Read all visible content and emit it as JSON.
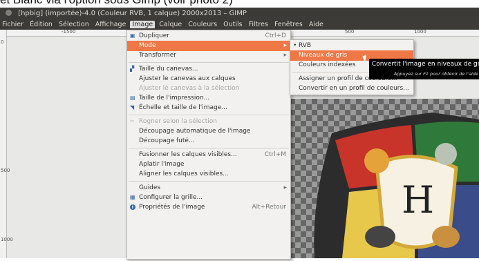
{
  "caption": "et Blanc via l'option sous Gimp (voir photo 2)",
  "window": {
    "title": "[hpbig] (importée)-4.0 (Couleur RVB, 1 calque) 2000x2013 – GIMP"
  },
  "menubar": [
    "Fichier",
    "Édition",
    "Sélection",
    "Affichage",
    "Image",
    "Calque",
    "Couleurs",
    "Outils",
    "Filtres",
    "Fenêtres",
    "Aide"
  ],
  "ruler": {
    "h": [
      "-1500",
      "500",
      "1000"
    ],
    "v": [
      "0",
      "500",
      "1000"
    ]
  },
  "image_menu": {
    "items": [
      {
        "label": "Dupliquer",
        "shortcut": "Ctrl+D",
        "icon": "duplicate-icon",
        "glyph": "▣"
      },
      {
        "label": "Mode",
        "submenu": true
      },
      {
        "label": "Transformer",
        "submenu": true
      },
      {
        "label": "Taille du canevas...",
        "icon": "canvas-size-icon",
        "glyph": "▞"
      },
      {
        "label": "Ajuster le canevas aux calques"
      },
      {
        "label": "Ajuster le canevas à la sélection",
        "disabled": true
      },
      {
        "label": "Taille de l'impression...",
        "icon": "print-size-icon",
        "glyph": "▤"
      },
      {
        "label": "Échelle et taille de l'image...",
        "icon": "scale-image-icon",
        "glyph": "◥"
      },
      {
        "label": "Rogner selon la sélection",
        "icon": "crop-icon",
        "glyph": "✂",
        "disabled": true
      },
      {
        "label": "Découpage automatique de l'image"
      },
      {
        "label": "Découpage futé..."
      },
      {
        "label": "Fusionner les calques visibles...",
        "shortcut": "Ctrl+M"
      },
      {
        "label": "Aplatir l'image"
      },
      {
        "label": "Aligner les calques visibles..."
      },
      {
        "label": "Guides",
        "submenu": true
      },
      {
        "label": "Configurer la grille...",
        "icon": "grid-icon",
        "glyph": "▦"
      },
      {
        "label": "Propriétés de l'image",
        "shortcut": "Alt+Retour",
        "icon": "info-icon",
        "glyph": "i"
      }
    ]
  },
  "mode_submenu": {
    "items": [
      {
        "label": "RVB",
        "checked": true
      },
      {
        "label": "Niveaux de gris"
      },
      {
        "label": "Couleurs indexées"
      },
      {
        "label": "Assigner un profil de couleurs..."
      },
      {
        "label": "Convertir en un profil de couleurs..."
      }
    ]
  },
  "tooltip": {
    "text": "Convertit l'image en niveaux de gris",
    "hint": "Appuyez sur F1 pour obtenir de l'aide"
  },
  "colors": {
    "highlight": "#f07746",
    "menubar_bg": "#3c3b37"
  }
}
